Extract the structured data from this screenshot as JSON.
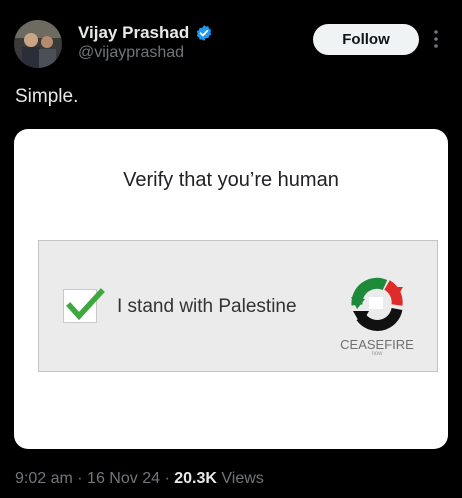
{
  "author": {
    "display_name": "Vijay Prashad",
    "handle": "@vijayprashad",
    "avatar_icon": "profile-photo",
    "verified_icon": "verified-badge-icon",
    "verified_color": "#1d9bf0"
  },
  "header": {
    "follow_label": "Follow",
    "more_icon": "more-vertical-icon"
  },
  "tweet": {
    "text": "Simple."
  },
  "media": {
    "title": "Verify that you’re human",
    "checkbox_checked": true,
    "checkbox_label": "I stand with Palestine",
    "brand_name": "CEASEFIRE",
    "brand_sub": "now",
    "logo_icon": "ceasefire-arrows-logo",
    "colors": {
      "red": "#e02b2b",
      "green": "#1d8a3a",
      "black": "#111111",
      "check": "#3ea83e"
    }
  },
  "meta": {
    "time": "9:02 am",
    "date": "16 Nov 24",
    "separator": "·",
    "views_count": "20.3K",
    "views_label": "Views"
  }
}
